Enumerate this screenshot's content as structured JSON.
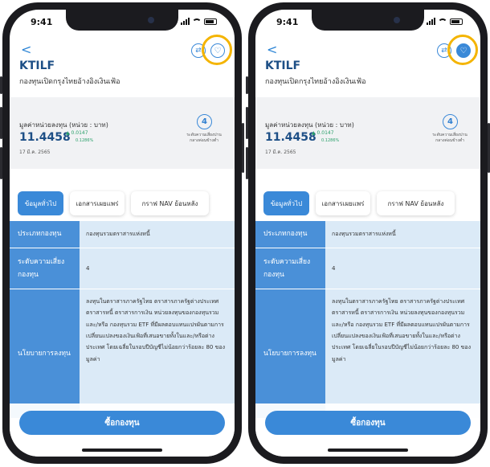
{
  "status": {
    "time": "9:41"
  },
  "screens": [
    {
      "favorite_active": false,
      "compare_symbol": "⇄",
      "favorite_symbol": "♡",
      "back_symbol": "<"
    },
    {
      "favorite_active": true,
      "compare_symbol": "⇄",
      "favorite_symbol": "♡",
      "back_symbol": "<"
    }
  ],
  "fund": {
    "code": "KTILF",
    "name": "กองทุนเปิดกรุงไทยอ้างอิงเงินเฟ้อ"
  },
  "nav": {
    "label": "มูลค่าหน่วยลงทุน (หน่วย : บาท)",
    "value": "11.4458",
    "change": "▲ 0.0147",
    "change_pct": "0.1286%",
    "date": "17 มี.ค. 2565",
    "risk_level": "4",
    "risk_text": "ระดับความเสี่ยงปานกลางค่อนข้างต่ำ"
  },
  "tabs": [
    "ข้อมูลทั่วไป",
    "เอกสารเผยแพร่",
    "กราฟ NAV ย้อนหลัง"
  ],
  "table": {
    "type_label": "ประเภทกองทุน",
    "type_value": "กองทุนรวมตราสารแห่งหนี้",
    "risk_label": "ระดับความเสี่ยงกองทุน",
    "risk_value": "4",
    "policy_label": "นโยบายการลงทุน",
    "policy_value": "ลงทุนในตราสารภาครัฐไทย ตราสารภาครัฐต่างประเทศ ตราสารหนี้ ตราสารการเงิน หน่วยลงทุนของกองทุนรวม และ/หรือ กองทุนรวม ETF ที่มีผลตอบแทนแปรผันตามการเปลี่ยนแปลงของเงินเฟ้อที่เสนอขายทั้งในและ/หรือต่างประเทศ โดยเฉลี่ยในรอบปีบัญชีไม่น้อยกว่าร้อยละ 80 ของมูลค่า"
  },
  "buy_label": "ซื้อกองทุน",
  "colors": {
    "accent": "#3a89d8",
    "highlight": "#f4b400",
    "navy": "#1d4f86"
  }
}
